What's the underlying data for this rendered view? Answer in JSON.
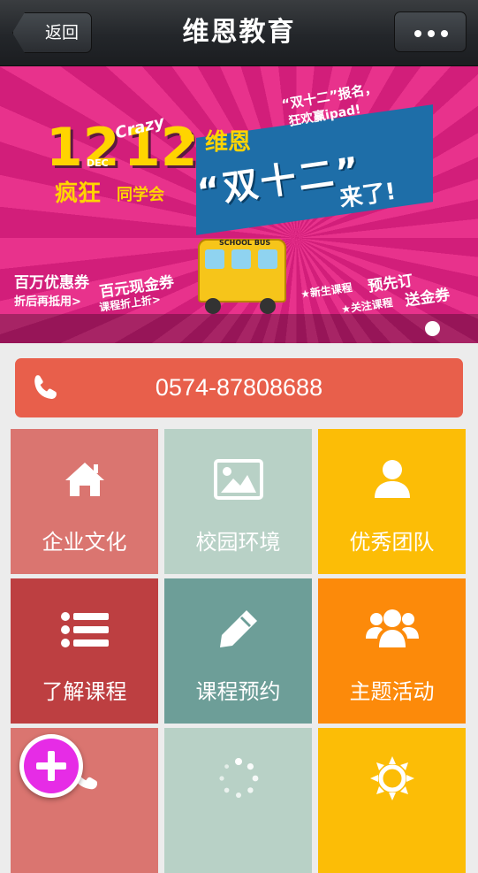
{
  "nav": {
    "back_label": "返回",
    "title": "维恩教育",
    "more_icon": "ellipsis-icon"
  },
  "banner": {
    "num1": "12",
    "num2": "12",
    "dec": "DEC",
    "crazy": "Crazy",
    "th": "th",
    "crazy_cn": "疯狂",
    "tongxue": "同学会",
    "weien": "维恩",
    "shuang": "“双十二”",
    "laile": "来了!",
    "baoming": "“双十二”报名，",
    "ipad": "狂欢赢ipad!",
    "school_bus": "SCHOOL BUS",
    "coupon": "百万优惠券",
    "coupon_sub": "折后再抵用>",
    "cash": "百元现金券",
    "cash_sub": "课程折上折>",
    "new_course": "★新生课程",
    "preorder": "预先订",
    "follow": "★关注课程",
    "gold": "送金券",
    "page_count": 1,
    "active_page": 1
  },
  "phone": {
    "number": "0574-87808688",
    "icon": "phone-icon",
    "color": "#e85f4b"
  },
  "tiles": [
    {
      "label": "企业文化",
      "icon": "home-icon",
      "color": "#da7570"
    },
    {
      "label": "校园环境",
      "icon": "image-icon",
      "color": "#b8d1c6"
    },
    {
      "label": "优秀团队",
      "icon": "user-icon",
      "color": "#fcbd06"
    },
    {
      "label": "了解课程",
      "icon": "list-icon",
      "color": "#bd3f41"
    },
    {
      "label": "课程预约",
      "icon": "pencil-icon",
      "color": "#6d9e98"
    },
    {
      "label": "主题活动",
      "icon": "group-icon",
      "color": "#fc8a0a"
    },
    {
      "label": "",
      "icon": "phone-icon",
      "color": "#da7570"
    },
    {
      "label": "",
      "icon": "spinner-icon",
      "color": "#b8d1c6"
    },
    {
      "label": "",
      "icon": "sun-icon",
      "color": "#fcbd06"
    }
  ],
  "fab": {
    "icon": "plus-icon",
    "color": "#e62ce6"
  }
}
